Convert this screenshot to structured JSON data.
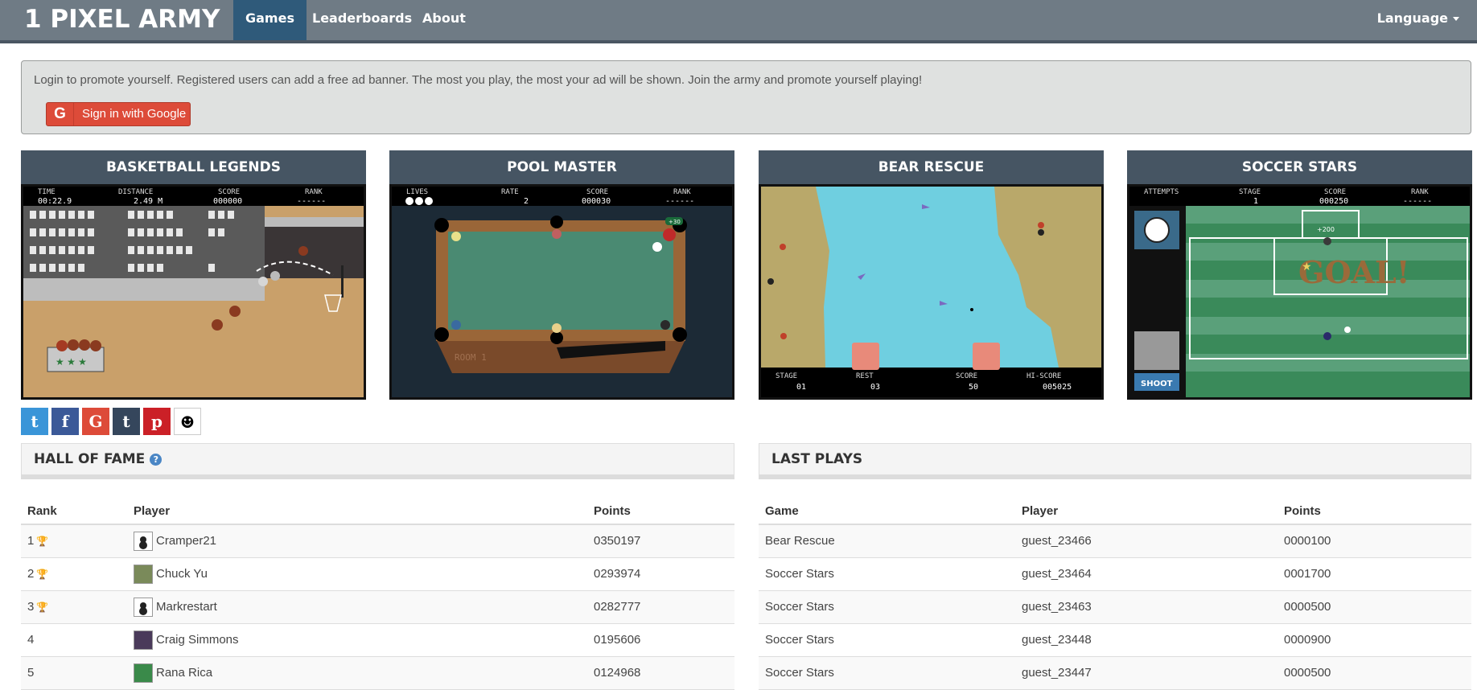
{
  "brand": "1 PIXEL ARMY",
  "nav": [
    {
      "label": "Games",
      "active": true
    },
    {
      "label": "Leaderboards",
      "active": false
    },
    {
      "label": "About",
      "active": false
    }
  ],
  "language_label": "Language",
  "alert": {
    "text": "Login to promote yourself. Registered users can add a free ad banner. The most you play, the most your ad will be shown. Join the army and promote yourself playing!",
    "google_button": "Sign in with Google"
  },
  "games": [
    {
      "title": "BASKETBALL LEGENDS",
      "hud": [
        "TIME",
        "DISTANCE",
        "SCORE",
        "RANK"
      ],
      "hud_values": [
        "00:22.9",
        "2.49 M",
        "000000",
        "------"
      ]
    },
    {
      "title": "POOL MASTER",
      "hud": [
        "LIVES",
        "RATE",
        "SCORE",
        "RANK"
      ],
      "hud_values": [
        "",
        "2",
        "000030",
        "------"
      ],
      "bonus": "+30",
      "room": "ROOM 1"
    },
    {
      "title": "BEAR RESCUE",
      "hud": [
        "STAGE",
        "REST",
        "SCORE",
        "HI-SCORE"
      ],
      "hud_values": [
        "01",
        "03",
        "50",
        "005025"
      ]
    },
    {
      "title": "SOCCER STARS",
      "hud": [
        "ATTEMPTS",
        "STAGE",
        "SCORE",
        "RANK"
      ],
      "hud_values": [
        "",
        "1",
        "000250",
        "------"
      ],
      "bonus": "+200",
      "goal": "GOAL!",
      "shoot": "SHOOT"
    }
  ],
  "social": [
    {
      "name": "twitter",
      "glyph": "t",
      "color": "#3a95d8"
    },
    {
      "name": "facebook",
      "glyph": "f",
      "color": "#3b5998"
    },
    {
      "name": "google",
      "glyph": "G",
      "color": "#dd4b39"
    },
    {
      "name": "tumblr",
      "glyph": "t",
      "color": "#35465c"
    },
    {
      "name": "pinterest",
      "glyph": "p",
      "color": "#cb2027"
    },
    {
      "name": "reddit",
      "glyph": "☻",
      "color": "#ffffff"
    }
  ],
  "hall_of_fame": {
    "title": "HALL OF FAME",
    "columns": [
      "Rank",
      "Player",
      "Points"
    ],
    "rows": [
      {
        "rank": "1",
        "trophy": "gold",
        "player": "Cramper21",
        "avatar": "blank",
        "points": "0350197"
      },
      {
        "rank": "2",
        "trophy": "silver",
        "player": "Chuck Yu",
        "avatar": "photo",
        "points": "0293974"
      },
      {
        "rank": "3",
        "trophy": "bronze",
        "player": "Markrestart",
        "avatar": "blank",
        "points": "0282777"
      },
      {
        "rank": "4",
        "trophy": "",
        "player": "Craig Simmons",
        "avatar": "photo",
        "points": "0195606"
      },
      {
        "rank": "5",
        "trophy": "",
        "player": "Rana Rica",
        "avatar": "photo",
        "points": "0124968"
      }
    ]
  },
  "last_plays": {
    "title": "LAST PLAYS",
    "columns": [
      "Game",
      "Player",
      "Points"
    ],
    "rows": [
      {
        "game": "Bear Rescue",
        "player": "guest_23466",
        "points": "0000100"
      },
      {
        "game": "Soccer Stars",
        "player": "guest_23464",
        "points": "0001700"
      },
      {
        "game": "Soccer Stars",
        "player": "guest_23463",
        "points": "0000500"
      },
      {
        "game": "Soccer Stars",
        "player": "guest_23448",
        "points": "0000900"
      },
      {
        "game": "Soccer Stars",
        "player": "guest_23447",
        "points": "0000500"
      }
    ]
  }
}
